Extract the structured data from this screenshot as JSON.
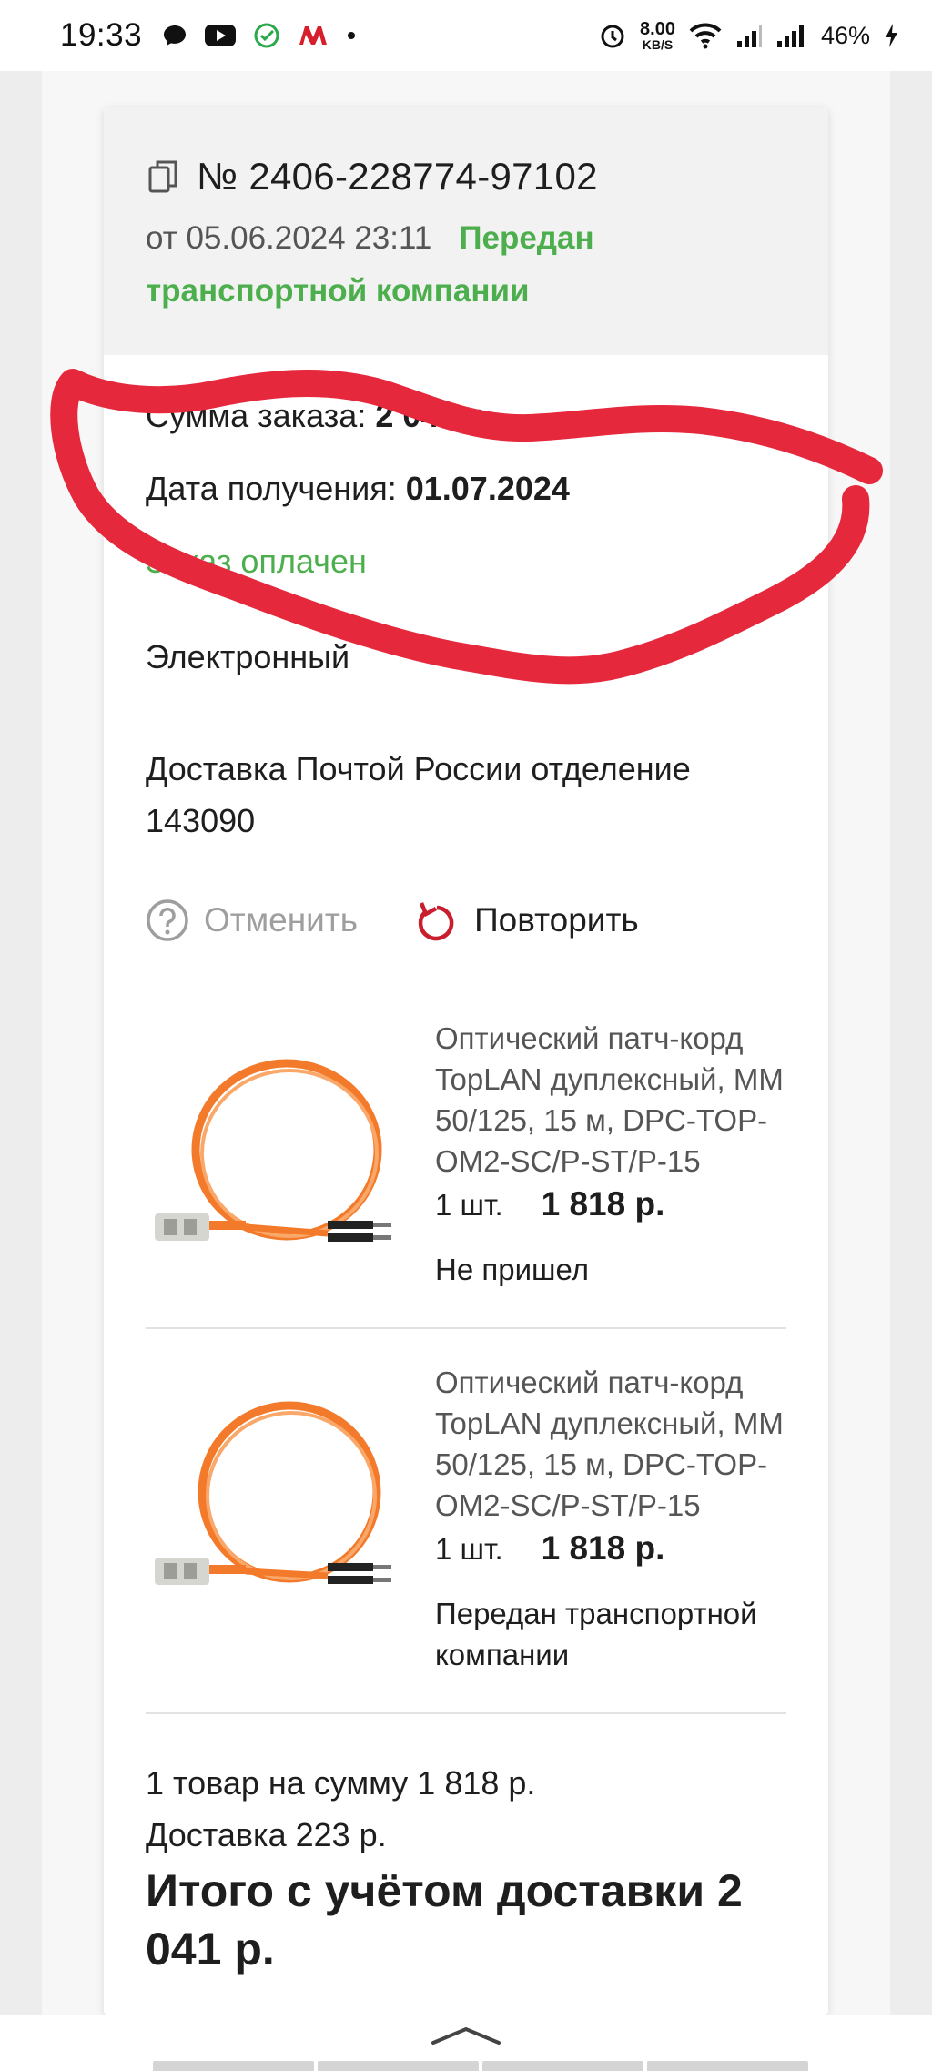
{
  "status_bar": {
    "time": "19:33",
    "net_speed_value": "8.00",
    "net_speed_unit": "KB/S",
    "battery": "46%"
  },
  "order": {
    "number": "№ 2406-228774-97102",
    "date": "от 05.06.2024 23:11",
    "status": "Передан транспортной компании",
    "sum_label": "Сумма заказа:",
    "sum_value": "2 041 р.",
    "receive_label": "Дата получения:",
    "receive_value": "01.07.2024",
    "paid_text": "Заказ оплачен",
    "payment_method": "Электронный",
    "delivery": "Доставка Почтой России отделение 143090"
  },
  "actions": {
    "cancel_label": "Отменить",
    "repeat_label": "Повторить"
  },
  "products": [
    {
      "name": "Оптический патч-корд TopLAN дуплексный, MM 50/125, 15 м, DPC-TOP-OM2-SC/P-ST/P-15",
      "qty": "1 шт.",
      "price": "1 818 р.",
      "status": "Не пришел"
    },
    {
      "name": "Оптический патч-корд TopLAN дуплексный, MM 50/125, 15 м, DPC-TOP-OM2-SC/P-ST/P-15",
      "qty": "1 шт.",
      "price": "1 818 р.",
      "status": "Передан транспортной компании"
    }
  ],
  "summary": {
    "items_line": "1 товар на сумму 1 818 р.",
    "delivery_line": "Доставка 223 р.",
    "total_line": "Итого с учётом доставки 2 041 р."
  },
  "colors": {
    "accent_green": "#4cae4c",
    "repeat_red": "#c81e2d",
    "scribble_red": "#e5283c"
  }
}
